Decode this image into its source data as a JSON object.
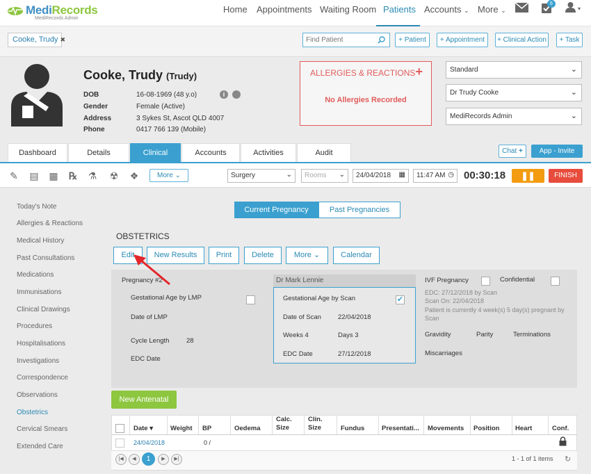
{
  "brand": {
    "name_a": "Medi",
    "name_b": "Records",
    "sub": "MediRecords Admin"
  },
  "nav": {
    "home": "Home",
    "appointments": "Appointments",
    "waiting_room": "Waiting Room",
    "patients": "Patients",
    "accounts": "Accounts",
    "more": "More",
    "badge": "6"
  },
  "patient_tab": {
    "label": "Cooke, Trudy",
    "close": "✖"
  },
  "search": {
    "placeholder": "Find Patient"
  },
  "quick": {
    "patient": "+ Patient",
    "appointment": "+ Appointment",
    "clinical_action": "+ Clinical Action",
    "task": "+ Task"
  },
  "patient": {
    "name": "Cooke, Trudy",
    "nick": "(Trudy)",
    "dob_label": "DOB",
    "dob": "16-08-1969 (48 y.o)",
    "gender_label": "Gender",
    "gender": "Female (Active)",
    "address_label": "Address",
    "address": "3 Sykes St, Ascot QLD 4007",
    "phone_label": "Phone",
    "phone": "0417 766 139 (Mobile)"
  },
  "allergies": {
    "title": "ALLERGIES & REACTIONS",
    "plus": "+",
    "none": "No Allergies Recorded"
  },
  "selects": {
    "billing": "Standard",
    "doctor": "Dr Trudy Cooke",
    "admin": "MediRecords Admin"
  },
  "tabs": [
    "Dashboard",
    "Details",
    "Clinical",
    "Accounts",
    "Activities",
    "Audit"
  ],
  "chat": {
    "label": "Chat",
    "plus": "+"
  },
  "app_invite": "App - Invite",
  "toolbar": {
    "more": "More",
    "location": "Surgery",
    "rooms": "Rooms",
    "date": "24/04/2018",
    "time": "11:47 AM",
    "timer": "00:30:18",
    "pause": "❚❚",
    "finish": "FINISH"
  },
  "sidebar": [
    "Today's Note",
    "Allergies & Reactions",
    "Medical History",
    "Past Consultations",
    "Medications",
    "Immunisations",
    "Clinical Drawings",
    "Procedures",
    "Hospitalisations",
    "Investigations",
    "Correspondence",
    "Observations",
    "Obstetrics",
    "Cervical Smears",
    "Extended Care"
  ],
  "segment": {
    "current": "Current Pregnancy",
    "past": "Past Pregnancies"
  },
  "section_title": "OBSTETRICS",
  "actions": {
    "edit": "Edit",
    "new_results": "New Results",
    "print": "Print",
    "delete": "Delete",
    "more": "More",
    "calendar": "Calendar"
  },
  "panel": {
    "pregnancy": "Pregnancy #2",
    "ga_lmp": "Gestational Age by LMP",
    "date_lmp": "Date of LMP",
    "cycle_length_label": "Cycle Length",
    "cycle_length": "28",
    "edc_date": "EDC Date",
    "doctor": "Dr Mark Lennie",
    "ga_scan": "Gestational Age by Scan",
    "date_scan_label": "Date of Scan",
    "date_scan": "22/04/2018",
    "weeks": "Weeks 4",
    "days": "Days 3",
    "edc_label": "EDC Date",
    "edc": "27/12/2018",
    "ivf": "IVF Pregnancy",
    "confidential": "Confidential",
    "note1": "EDC: 27/12/2018 by Scan",
    "note2": "Scan On: 22/04/2018",
    "note3": "Patient is currently 4 week(s) 5 day(s) pregnant by",
    "note4": "Scan",
    "gravidity": "Gravidity",
    "parity": "Parity",
    "terminations": "Terminations",
    "miscarriages": "Miscarriages"
  },
  "new_antenatal": "New Antenatal",
  "grid": {
    "headers": [
      "Date ▾",
      "Weight",
      "BP",
      "Oedema",
      "Calc. Size",
      "Clin. Size",
      "Fundus",
      "Presentati...",
      "Movements",
      "Position",
      "Heart",
      "Conf."
    ],
    "row": {
      "date": "24/04/2018",
      "bp": "0 /"
    },
    "pager": {
      "page": "1",
      "count": "1 - 1 of 1 items"
    }
  }
}
